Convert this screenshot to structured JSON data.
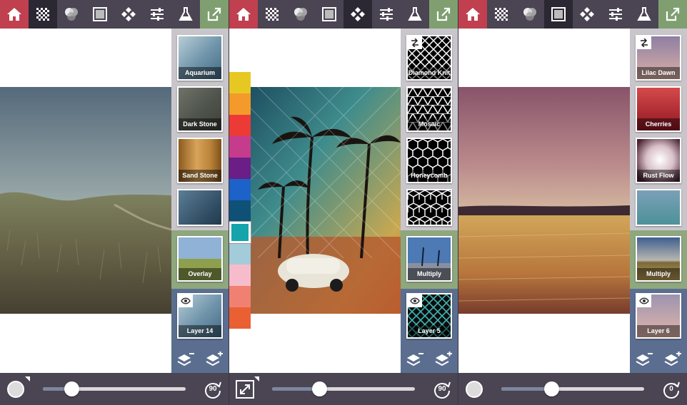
{
  "panels": [
    {
      "id": "p1",
      "active_tool": "texture",
      "layers": [
        {
          "label": "Aquarium",
          "fill": "aquarium"
        },
        {
          "label": "Dark Stone",
          "fill": "darkstone"
        },
        {
          "label": "Sand Stone",
          "fill": "sandstone"
        },
        {
          "label": "",
          "fill": "bluestone"
        }
      ],
      "blend_label": "Overlay",
      "current_layer": "Layer 14",
      "slider_value": 0.2,
      "rotate_label": "90"
    },
    {
      "id": "p2",
      "active_tool": "geometry",
      "layers": [
        {
          "label": "Diamond Knit",
          "fill": "diamond"
        },
        {
          "label": "Mosaic",
          "fill": "mosaic"
        },
        {
          "label": "Honeycomb",
          "fill": "honeycomb"
        },
        {
          "label": "",
          "fill": "cubes"
        }
      ],
      "blend_label": "Multiply",
      "current_layer": "Layer 5",
      "slider_value": 0.33,
      "rotate_label": "90",
      "palette": [
        "#e7c822",
        "#f39a2a",
        "#ec3a37",
        "#c63c8c",
        "#6a1e86",
        "#1c62c8",
        "#0f5076",
        "#15a3ac",
        "#a3cbd9",
        "#f6bccb",
        "#f08172",
        "#ea6032"
      ],
      "palette_selected": 7
    },
    {
      "id": "p3",
      "active_tool": "gradient",
      "layers": [
        {
          "label": "Lilac Dawn",
          "fill": "lilac"
        },
        {
          "label": "Cherries",
          "fill": "cherries"
        },
        {
          "label": "Rust Flow",
          "fill": "rust"
        },
        {
          "label": "",
          "fill": "teal"
        }
      ],
      "blend_label": "Multiply",
      "current_layer": "Layer 6",
      "slider_value": 0.35,
      "rotate_label": "0"
    }
  ],
  "colors": {
    "toolbar": "#4a4453",
    "home": "#c0404f",
    "export": "#7f9f70",
    "layer_panel_top": "#c9c6cb",
    "layer_panel_mid": "#8ea77e",
    "layer_panel_bottom": "#5b6e90"
  }
}
